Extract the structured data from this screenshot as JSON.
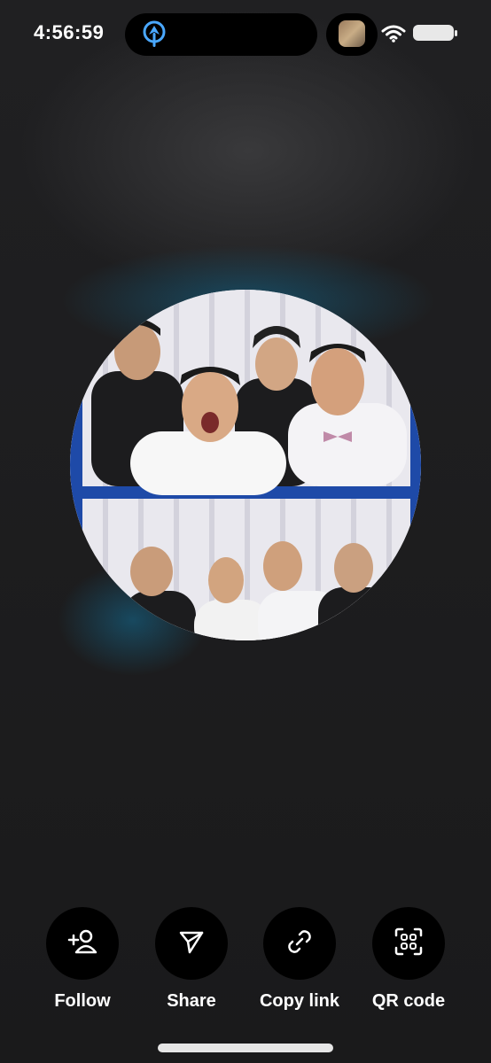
{
  "status_bar": {
    "time": "4:56:59",
    "icons": [
      "location-arrow-icon",
      "wifi-icon",
      "battery-icon"
    ]
  },
  "profile": {
    "avatar_alt": "profile-photo"
  },
  "actions": [
    {
      "label": "Follow",
      "icon": "follow-person-plus-icon"
    },
    {
      "label": "Share",
      "icon": "send-paper-plane-icon"
    },
    {
      "label": "Copy link",
      "icon": "link-icon"
    },
    {
      "label": "QR code",
      "icon": "qr-code-icon"
    }
  ],
  "colors": {
    "background": "#1b1b1c",
    "accent_glow": "#146e96",
    "button_bg": "#000000",
    "text": "#ffffff"
  }
}
